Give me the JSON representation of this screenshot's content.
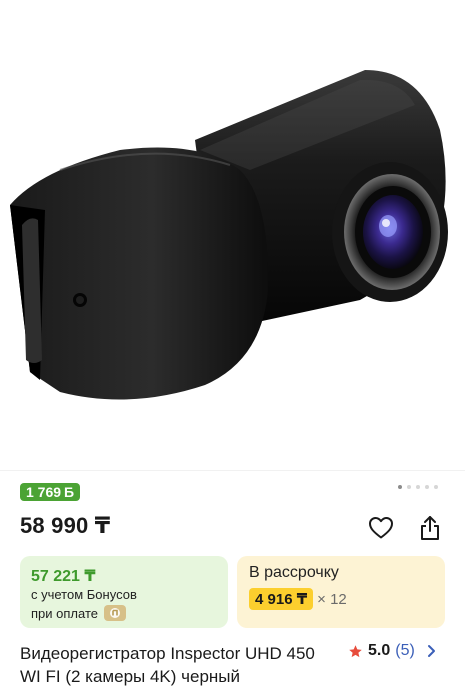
{
  "product": {
    "bonus_badge": "1 769",
    "bonus_currency_symbol": "Б",
    "price": "58 990 ₸",
    "title": "Видеорегистратор Inspector UHD 450 WI FI (2 камеры 4K) черный",
    "image_alt": "Видеорегистратор Inspector UHD 450 WI FI"
  },
  "gallery": {
    "dot_count": 5,
    "active_index": 0
  },
  "bonus_card": {
    "amount": "57 221 ₸",
    "line1": "с учетом Бонусов",
    "line2": "при оплате"
  },
  "installment_card": {
    "title": "В рассрочку",
    "monthly": "4 916 ₸",
    "times": "× 12"
  },
  "rating": {
    "score": "5.0",
    "count": "(5)"
  },
  "colors": {
    "badge_green": "#4ba334",
    "bonus_bg": "#e7f6dd",
    "install_bg": "#fdf3d4",
    "install_highlight": "#fccf2e",
    "star": "#e74c3c",
    "link_blue": "#3b5fb8"
  },
  "icons": {
    "favorite": "heart-icon",
    "share": "share-icon",
    "star": "star-icon",
    "chevron": "chevron-right-icon",
    "bonus": "bonus-coin-icon",
    "payment": "payment-badge-icon"
  }
}
